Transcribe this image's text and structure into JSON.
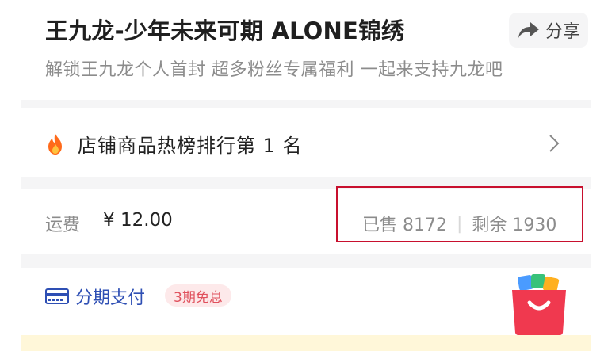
{
  "product": {
    "title": "王九龙-少年未来可期 ALONE锦绣",
    "subtitle": "解锁王九龙个人首封 超多粉丝专属福利 一起来支持九龙吧"
  },
  "share": {
    "label": "分享",
    "icon": "share-arrow-icon"
  },
  "ranking": {
    "text": "店铺商品热榜排行第 1 名",
    "icon": "fire-icon"
  },
  "shipping": {
    "label": "运费",
    "value": "¥ 12.00"
  },
  "sales": {
    "sold": "已售 8172",
    "separator": "|",
    "remaining": "剩余 1930"
  },
  "payment": {
    "label": "分期支付",
    "badge": "3期免息",
    "icon": "card-icon"
  },
  "colors": {
    "accent_blue": "#2e4fb4",
    "badge_red": "#e0515d",
    "highlight_border": "#c8102e",
    "fire_orange": "#ff6a1a"
  }
}
